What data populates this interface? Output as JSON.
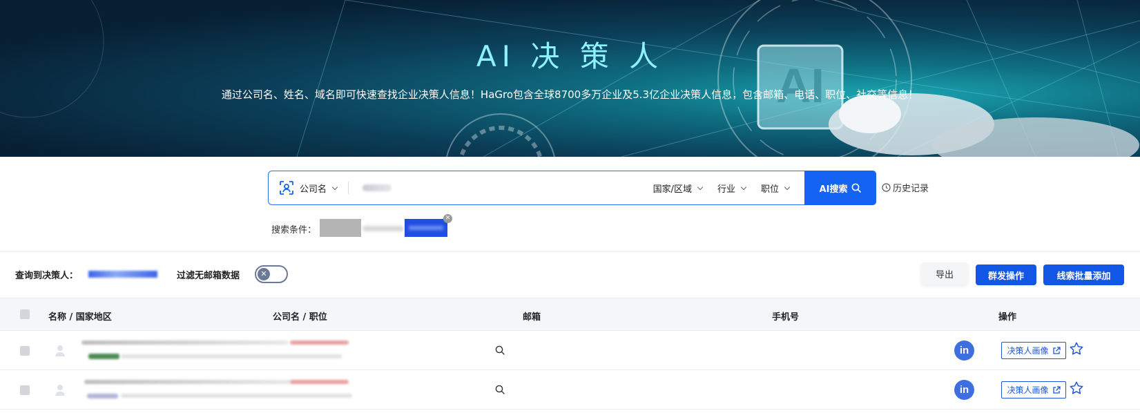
{
  "banner": {
    "title": "AI 决 策 人",
    "subtitle": "通过公司名、姓名、域名即可快速查找企业决策人信息！HaGro包含全球8700多万企业及5.3亿企业决策人信息，包含邮箱、电话、职位、社交等信息！",
    "badge_text": "AI"
  },
  "search": {
    "scope_label": "公司名",
    "filters": [
      "国家/区域",
      "行业",
      "职位"
    ],
    "button_label": "AI搜索",
    "history_label": "历史记录",
    "conditions_label": "搜索条件："
  },
  "toolbar": {
    "found_label": "查询到决策人：",
    "filter_no_email_label": "过滤无邮箱数据",
    "toggle_on": false,
    "export_label": "导出",
    "group_send_label": "群发操作",
    "batch_add_label": "线索批量添加"
  },
  "table": {
    "headers": {
      "name": "名称 / 国家地区",
      "company": "公司名 / 职位",
      "email": "邮箱",
      "phone": "手机号",
      "actions": "操作"
    },
    "rows": [
      {
        "linkedin_label": "in",
        "portrait_label": "决策人画像"
      },
      {
        "linkedin_label": "in",
        "portrait_label": "决策人画像"
      }
    ]
  },
  "colors": {
    "primary": "#1563f2",
    "banner_title": "#8ff0ff",
    "linkedin": "#3d6fe0"
  },
  "icons": {
    "scope": "person-scan-icon",
    "search": "search-icon",
    "history": "clock-icon",
    "external": "external-link-icon",
    "favorite": "star-icon"
  }
}
